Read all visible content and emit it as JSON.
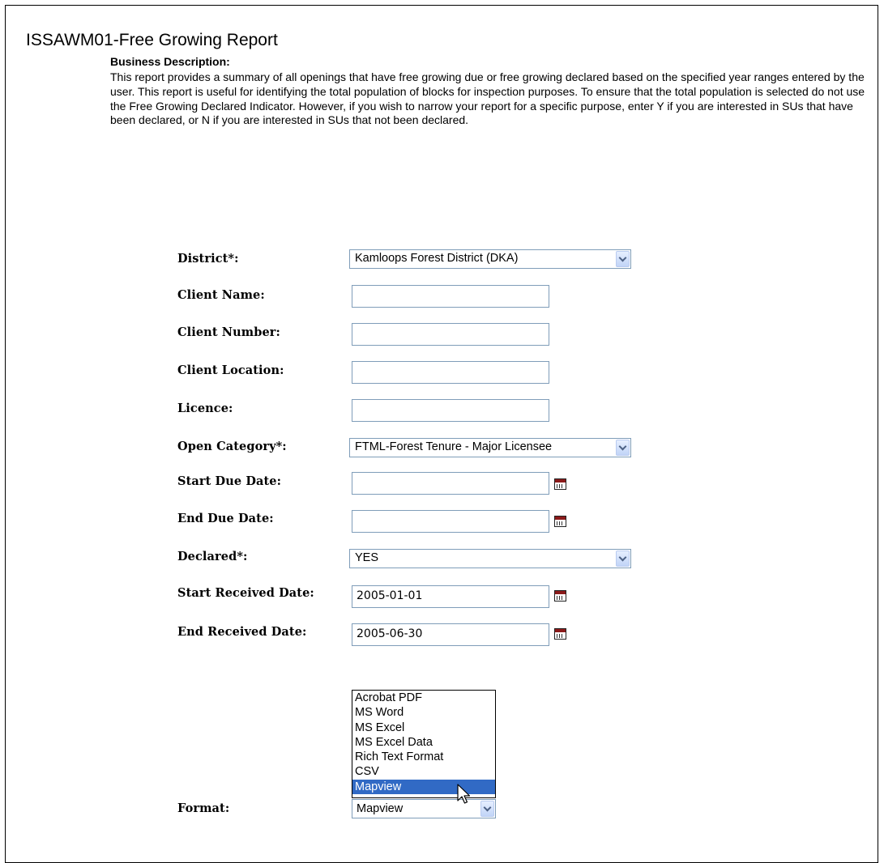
{
  "report": {
    "title": "ISSAWM01-Free Growing Report",
    "description_heading": "Business Description:",
    "description_text": "This report provides a summary of all openings that have free growing due or free growing declared based on the specified year ranges entered by the user. This report is useful for identifying the total population of blocks for inspection purposes. To ensure that the total population is selected do not use the Free Growing Declared Indicator. However, if you wish to narrow your report for a specific purpose, enter Y if you are interested in SUs that have been declared, or N if you are interested in SUs that not been declared."
  },
  "form": {
    "district": {
      "label": "District",
      "required_mark": "*:",
      "value": "Kamloops Forest District (DKA)"
    },
    "client_name": {
      "label": "Client Name:",
      "value": ""
    },
    "client_number": {
      "label": "Client Number:",
      "value": ""
    },
    "client_location": {
      "label": "Client Location:",
      "value": ""
    },
    "licence": {
      "label": "Licence:",
      "value": ""
    },
    "open_category": {
      "label": "Open Category",
      "required_mark": "*:",
      "value": "FTML-Forest Tenure - Major Licensee"
    },
    "start_due_date": {
      "label": "Start Due Date:",
      "value": ""
    },
    "end_due_date": {
      "label": "End Due Date:",
      "value": ""
    },
    "declared": {
      "label": "Declared",
      "required_mark": "*:",
      "value": "YES"
    },
    "start_received_date": {
      "label": "Start Received Date:",
      "value": "2005-01-01"
    },
    "end_received_date": {
      "label": "End Received Date:",
      "value": "2005-06-30"
    },
    "format": {
      "label": "Format:",
      "value": "Mapview",
      "options": [
        "Acrobat PDF",
        "MS Word",
        "MS Excel",
        "MS Excel Data",
        "Rich Text Format",
        "CSV",
        "Mapview"
      ],
      "highlighted": "Mapview"
    }
  },
  "icons": {
    "calendar": "calendar-icon",
    "dropdown": "chevron-down-icon",
    "cursor": "pointer-cursor-icon"
  },
  "colors": {
    "selection": "#316ac5",
    "input_border": "#7f9db9"
  }
}
